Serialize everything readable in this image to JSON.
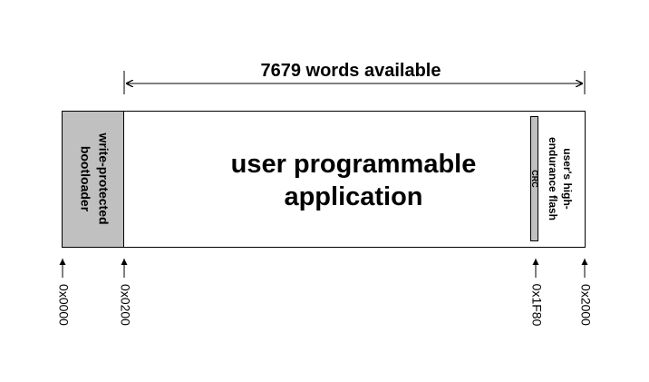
{
  "span_label": "7679 words available",
  "regions": {
    "bootloader": {
      "line1": "write-protected",
      "line2": "bootloader",
      "fill": "#c0c0c0"
    },
    "application": {
      "line1": "user programmable",
      "line2": "application"
    },
    "crc": {
      "label": "CRC",
      "fill": "#c0c0c0"
    },
    "high_endurance": {
      "line1": "user's high-",
      "line2": "endurance flash"
    }
  },
  "addresses": [
    "0x0000",
    "0x0200",
    "0x1F80",
    "0x2000"
  ],
  "colors": {
    "stroke": "#000000",
    "background": "#ffffff",
    "gray": "#c0c0c0"
  }
}
